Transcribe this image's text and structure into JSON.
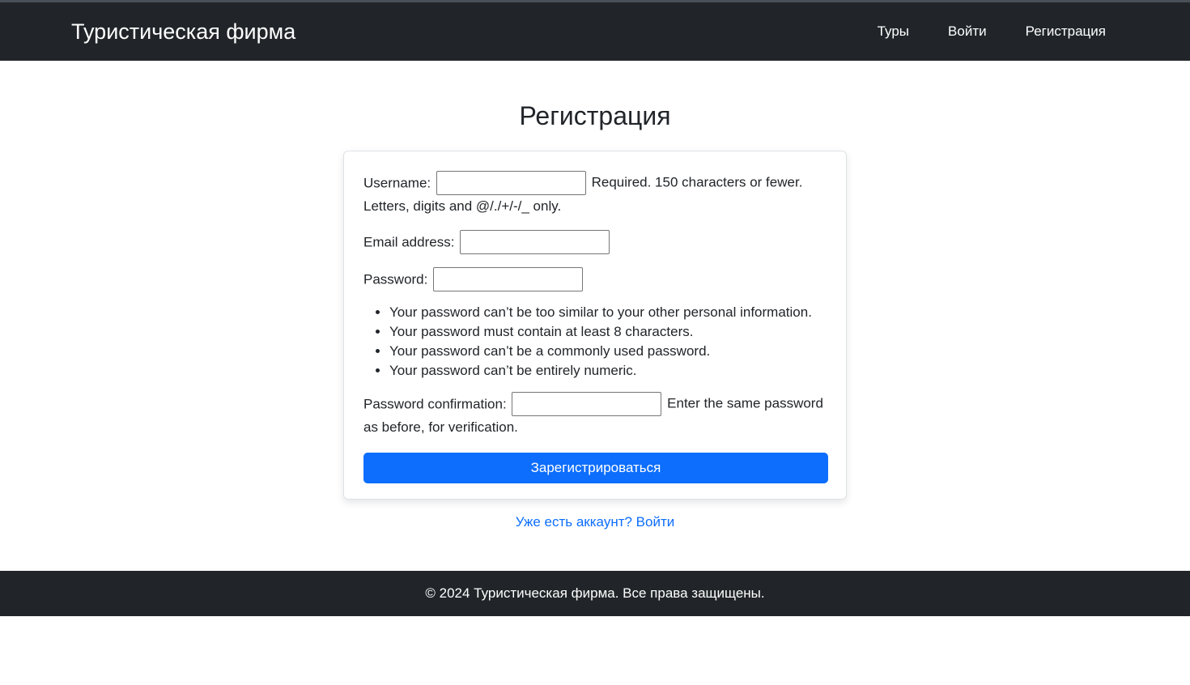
{
  "navbar": {
    "brand": "Туристическая фирма",
    "links": [
      "Туры",
      "Войти",
      "Регистрация"
    ]
  },
  "page": {
    "title": "Регистрация"
  },
  "form": {
    "username": {
      "label": "Username:",
      "value": "",
      "help": "Required. 150 characters or fewer. Letters, digits and @/./+/-/_ only."
    },
    "email": {
      "label": "Email address:",
      "value": ""
    },
    "password": {
      "label": "Password:",
      "value": ""
    },
    "password_rules": [
      "Your password can’t be too similar to your other personal information.",
      "Your password must contain at least 8 characters.",
      "Your password can’t be a commonly used password.",
      "Your password can’t be entirely numeric."
    ],
    "password_confirmation": {
      "label": "Password confirmation:",
      "value": "",
      "help": "Enter the same password as before, for verification."
    },
    "submit_label": "Зарегистрироваться"
  },
  "login_link": "Уже есть аккаунт? Войти",
  "footer": {
    "text": "© 2024 Туристическая фирма. Все права защищены."
  },
  "colors": {
    "navbar_bg": "#212529",
    "primary": "#0d6efd"
  }
}
